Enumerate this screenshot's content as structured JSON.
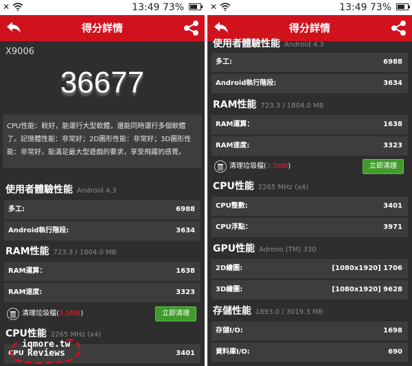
{
  "status_bar": {
    "time": "13:49",
    "battery": "73%",
    "battery_level": 0.73
  },
  "app_bar": {
    "title": "得分詳情"
  },
  "left": {
    "device": "X9006",
    "score": "36677",
    "description": "CPU性能：較好，能運行大型軟體，還能同時運行多個軟體了。記憶體性能：非常好；2D圖形性能：非常好；3D圖形性能：非常好，能滿足最大型遊戲的要求，享受飛躍的感覺。",
    "ux": {
      "title": "使用者體驗性能",
      "sub": "Android 4.3",
      "rows": [
        {
          "label": "多工:",
          "value": "6988"
        },
        {
          "label": "Android執行階段:",
          "value": "3634"
        }
      ]
    },
    "ram": {
      "title": "RAM性能",
      "sub": "723.3 / 1804.0 MB",
      "rows": [
        {
          "label": "RAM運算：",
          "value": "1638"
        },
        {
          "label": "RAM速度:",
          "value": "3323"
        }
      ]
    },
    "clean": {
      "label": "清理垃圾檔(",
      "mb": "3.5MB",
      "close": ")",
      "button": "立即清理"
    },
    "cpu": {
      "title": "CPU性能",
      "sub": "2265 MHz (x4)",
      "rows": [
        {
          "label": "CPU",
          "value": "3401"
        }
      ]
    },
    "watermark": {
      "line1": "iqmore.tw",
      "line2": "Reviews"
    }
  },
  "right": {
    "ux": {
      "title": "使用者體驗性能",
      "sub": "Android 4.3",
      "rows": [
        {
          "label": "多工:",
          "value": "6988"
        },
        {
          "label": "Android執行階段:",
          "value": "3634"
        }
      ]
    },
    "ram": {
      "title": "RAM性能",
      "sub": "723.3 / 1804.0 MB",
      "rows": [
        {
          "label": "RAM運算：",
          "value": "1638"
        },
        {
          "label": "RAM速度:",
          "value": "3323"
        }
      ]
    },
    "clean": {
      "label": "清理垃圾檔(",
      "mb": "3.5MB",
      "close": ")",
      "button": "立即清理"
    },
    "cpu": {
      "title": "CPU性能",
      "sub": "2265 MHz (x4)",
      "rows": [
        {
          "label": "CPU整數:",
          "value": "3401"
        },
        {
          "label": "CPU浮點：",
          "value": "3971"
        }
      ]
    },
    "gpu": {
      "title": "GPU性能",
      "sub": "Adreno (TM) 330",
      "rows": [
        {
          "label": "2D繪圖:",
          "value": "[1080x1920] 1706"
        },
        {
          "label": "3D繪圖:",
          "value": "[1080x1920] 9628"
        }
      ]
    },
    "storage": {
      "title": "存儲性能",
      "sub": "1893.0 / 3019.3 MB",
      "rows": [
        {
          "label": "存儲I/O:",
          "value": "1698"
        },
        {
          "label": "資料庫I/O:",
          "value": "690"
        }
      ]
    }
  },
  "colors": {
    "accent": "#d0121d",
    "button": "#3f9c2b",
    "highlight": "#e0242e",
    "background": "#2e2e2e",
    "row": "#3d3d3d"
  }
}
